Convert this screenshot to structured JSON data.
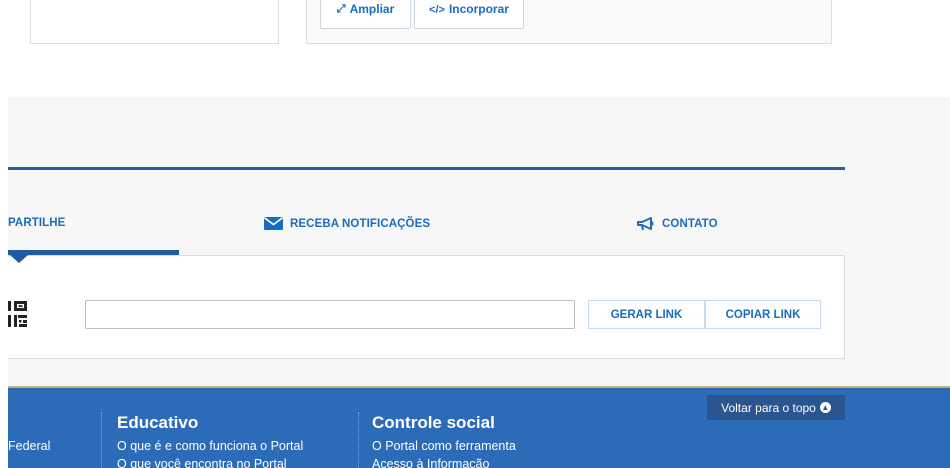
{
  "top_cards": {
    "ampliar_label": "Ampliar",
    "incorporar_label": "Incorporar",
    "ampliar_icon": "expand-icon",
    "incorporar_icon": "code-icon"
  },
  "share": {
    "tabs": [
      {
        "label": "PARTILHE",
        "icon": null
      },
      {
        "label": "RECEBA NOTIFICAÇÕES",
        "icon": "envelope-icon"
      },
      {
        "label": "CONTATO",
        "icon": "megaphone-icon"
      }
    ],
    "active_tab": 0,
    "input_value": "",
    "input_placeholder": "",
    "gerar_label": "GERAR LINK",
    "copiar_label": "COPIAR LINK",
    "qr_icon": "qr-code-icon"
  },
  "footer": {
    "col1_link": "Federal",
    "columns": [
      {
        "heading": "Educativo",
        "links": [
          "O que é e como funciona o Portal",
          "O que você encontra no Portal"
        ]
      },
      {
        "heading": "Controle social",
        "links": [
          "O Portal como ferramenta",
          "Acesso à Informação"
        ]
      }
    ],
    "back_to_top_label": "Voltar para o topo"
  },
  "colors": {
    "accent": "#1a6cc1",
    "rule": "#2b5f9e",
    "footer_bg": "#2b6bb7",
    "back_to_top_bg": "#2a5590"
  }
}
